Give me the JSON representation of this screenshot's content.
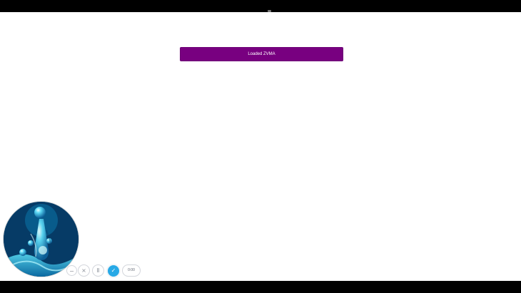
{
  "main": {
    "primary_button": {
      "label": "Loaded ZVMA"
    }
  },
  "recording_controls": {
    "minimize_icon": "minimize-icon",
    "cancel_icon": "close-icon",
    "pause_icon": "pause-icon",
    "done_icon": "check-icon",
    "timer": "0:00"
  },
  "colors": {
    "primary_button": "#780080",
    "done_button": "#27a9e6",
    "letterbox": "#000000"
  }
}
